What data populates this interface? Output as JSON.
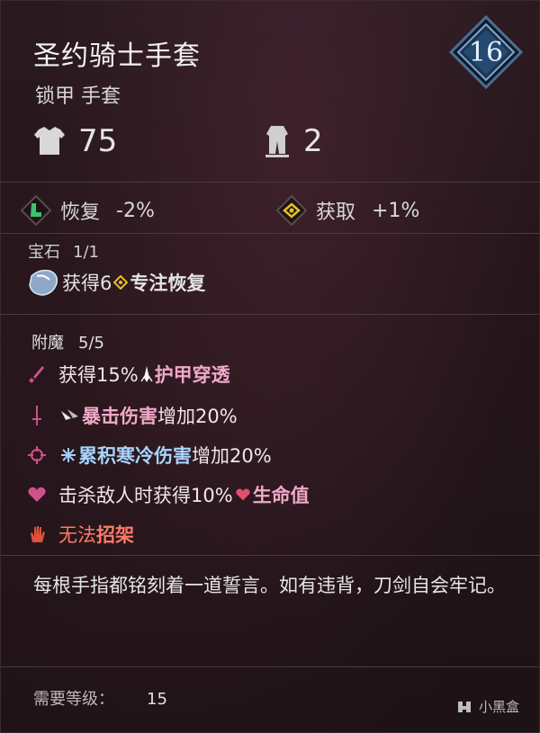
{
  "item": {
    "name": "圣约骑士手套",
    "type": "锁甲 手套",
    "level": "16"
  },
  "stats": {
    "armor": "75",
    "weight": "2"
  },
  "attributes": {
    "recovery_label": "恢复",
    "recovery_value": "-2%",
    "gain_label": "获取",
    "gain_value": "+1%"
  },
  "gems": {
    "label": "宝石",
    "count": "1/1",
    "effect_prefix": "获得6",
    "effect_keyword": "专注恢复"
  },
  "enchants": {
    "label": "附魔",
    "count": "5/5",
    "items": [
      {
        "prefix": "获得15%",
        "keyword": "护甲穿透",
        "suffix": ""
      },
      {
        "prefix": "",
        "keyword": "暴击伤害",
        "suffix": "增加20%"
      },
      {
        "prefix": "",
        "keyword": "累积寒冷伤害",
        "suffix": "增加20%"
      },
      {
        "prefix": "击杀敌人时获得10%",
        "keyword": "生命值",
        "suffix": ""
      },
      {
        "prefix": "无法",
        "keyword": "招架",
        "suffix": ""
      }
    ]
  },
  "flavor_text": "每根手指都铭刻着一道誓言。如有违背，刀剑自会牢记。",
  "requirement": {
    "label": "需要等级：",
    "value": "15"
  },
  "watermark": "小黑盒",
  "colors": {
    "keyword_pink": "#f0a8c8",
    "keyword_blue": "#a8d4ff",
    "keyword_red": "#ff7a6a",
    "gem_border": "#1e3a5a",
    "gem_fill": "#2a5a8a"
  }
}
